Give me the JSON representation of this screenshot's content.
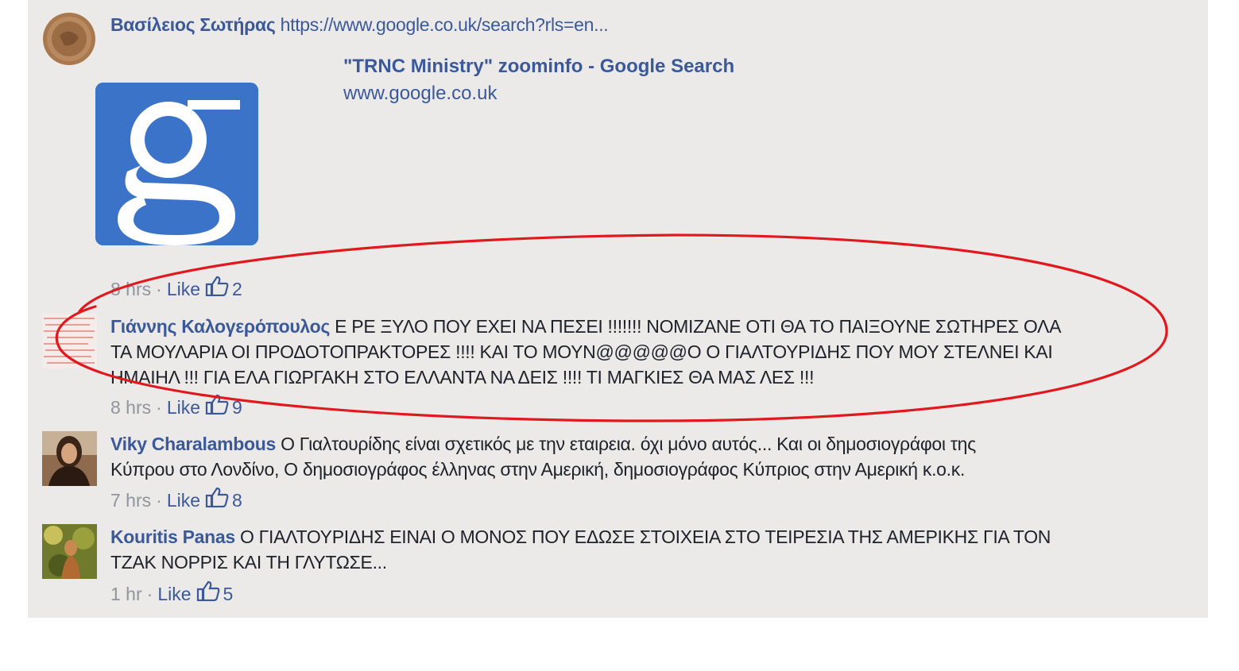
{
  "comments": [
    {
      "author": "Βασίλειος Σωτήρας",
      "text_lines": [
        "https://www.google.co.uk/search?rls=en..."
      ],
      "preview": {
        "title": "\"TRNC Ministry\" zoominfo - Google Search",
        "domain": "www.google.co.uk"
      },
      "time": "8 hrs",
      "like_label": "Like",
      "likes": "2"
    },
    {
      "author": "Γιάννης Καλογερόπουλος",
      "text_lines": [
        "Ε ΡΕ ΞΥΛΟ ΠΟΥ ΕΧΕΙ ΝΑ ΠΕΣΕΙ !!!!!!! ΝΟΜΙΖΑΝΕ ΟΤΙ ΘΑ ΤΟ ΠΑΙΞΟΥΝΕ ΣΩΤΗΡΕΣ ΟΛΑ",
        "ΤΑ ΜΟΥΛΑΡΙΑ ΟΙ ΠΡΟΔΟΤΟΠΡΑΚΤΟΡΕΣ !!!! ΚΑΙ ΤΟ ΜΟΥΝ@@@@@Ο Ο ΓΙΑΛΤΟΥΡΙΔΗΣ ΠΟΥ ΜΟΥ ΣΤΕΛΝΕΙ ΚΑΙ",
        "ΗΜΑΙΗΛ !!! ΓΙΑ ΕΛΑ ΓΙΩΡΓΑΚΗ ΣΤΟ ΕΛΛΑΝΤΑ ΝΑ ΔΕΙΣ !!!! ΤΙ ΜΑΓΚΙΕΣ ΘΑ ΜΑΣ ΛΕΣ !!!"
      ],
      "time": "8 hrs",
      "like_label": "Like",
      "likes": "9"
    },
    {
      "author": "Viky Charalambous",
      "text_lines": [
        "Ο Γιαλτουρίδης είναι σχετικός με την εταιρεια. όχι μόνο αυτός... Και οι δημοσιογράφοι της",
        "Κύπρου στο Λονδίνο, Ο δημοσιογράφος έλληνας στην Αμερική, δημοσιογράφος Κύπριος στην Αμερική κ.ο.κ."
      ],
      "time": "7 hrs",
      "like_label": "Like",
      "likes": "8"
    },
    {
      "author": "Kouritis Panas",
      "text_lines": [
        "Ο ΓΙΑΛΤΟΥΡΙΔΗΣ ΕΙΝΑΙ Ο ΜΟΝΟΣ ΠΟΥ ΕΔΩΣΕ ΣΤΟΙΧΕΙΑ ΣΤΟ ΤΕΙΡΕΣΙΑ ΤΗΣ ΑΜΕΡΙΚΗΣ ΓΙΑ ΤΟΝ",
        "ΤΖΑΚ ΝΟΡΡΙΣ ΚΑΙ ΤΗ ΓΛΥΤΩΣΕ..."
      ],
      "time": "1 hr",
      "like_label": "Like",
      "likes": "5"
    }
  ],
  "colors": {
    "panel": "#eceae8",
    "link": "#3b5998",
    "meta": "#90949c",
    "annotation": "#e0191f",
    "google_blue": "#3b73c8"
  },
  "icons": {
    "like": "thumbs-up-icon",
    "preview": "google-g-icon"
  }
}
